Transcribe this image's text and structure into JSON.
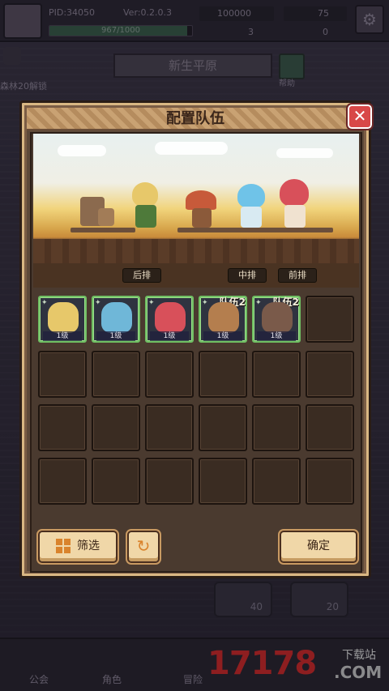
{
  "topbar": {
    "pid": "PID:34050",
    "version": "Ver:0.2.0.3",
    "xp_text": "967/1000",
    "xp_fraction": 0.967,
    "gold": "100000",
    "gems": "75",
    "res3": "3",
    "res4": "0"
  },
  "background": {
    "region_title": "新生平原",
    "help_label": "帮助",
    "unlock_text": "森林20解锁",
    "side_stat_left": "40",
    "side_stat_right": "20"
  },
  "nav": {
    "items": [
      {
        "label": "公会"
      },
      {
        "label": "角色"
      },
      {
        "label": "冒险"
      }
    ]
  },
  "modal": {
    "title": "配置队伍",
    "close_label": "✕",
    "row_labels": {
      "back": "后排",
      "middle": "中排",
      "front": "前排"
    },
    "roster": [
      {
        "level": "1级",
        "team": "",
        "color": "#e7c86a"
      },
      {
        "level": "1级",
        "team": "",
        "color": "#6fb7d8"
      },
      {
        "level": "1级",
        "team": "",
        "color": "#d8505a"
      },
      {
        "level": "1级",
        "team": "队伍2",
        "color": "#b47e4e"
      },
      {
        "level": "1级",
        "team": "队伍2",
        "color": "#7a5a4a"
      }
    ],
    "filter_label": "筛选",
    "confirm_label": "确定"
  },
  "watermark": {
    "number": "17178",
    "domain": ".COM",
    "tag": "下载站"
  },
  "colors": {
    "modal_frame": "#5e4a3a",
    "accent_green": "#6fbf63",
    "close_red": "#d84848",
    "button_cream": "#f0d7a8"
  }
}
